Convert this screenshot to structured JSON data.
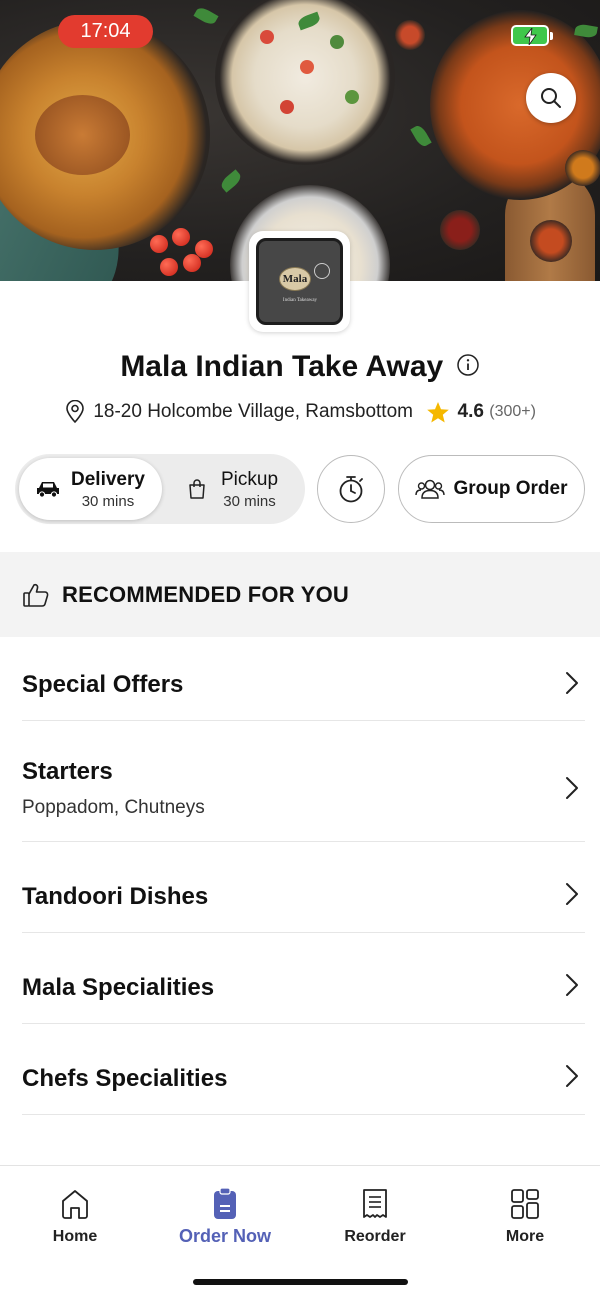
{
  "status_bar": {
    "time": "17:04"
  },
  "restaurant": {
    "name": "Mala Indian Take Away",
    "address": "18-20 Holcombe Village, Ramsbottom",
    "rating": "4.6",
    "rating_count": "(300+)",
    "logo_text": "Mala",
    "logo_subtext": "Indian Takeaway"
  },
  "order_mode": {
    "delivery": {
      "label": "Delivery",
      "time": "30 mins"
    },
    "pickup": {
      "label": "Pickup",
      "time": "30 mins"
    },
    "selected": "delivery"
  },
  "group_order_label": "Group Order",
  "recommended_title": "RECOMMENDED FOR YOU",
  "menu_categories": [
    {
      "name": "Special Offers",
      "description": ""
    },
    {
      "name": "Starters",
      "description": "Poppadom, Chutneys"
    },
    {
      "name": "Tandoori Dishes",
      "description": ""
    },
    {
      "name": "Mala Specialities",
      "description": ""
    },
    {
      "name": "Chefs Specialities",
      "description": ""
    }
  ],
  "bottom_nav": [
    {
      "label": "Home",
      "icon": "home-icon"
    },
    {
      "label": "Order Now",
      "icon": "order-icon",
      "active": true
    },
    {
      "label": "Reorder",
      "icon": "receipt-icon"
    },
    {
      "label": "More",
      "icon": "grid-icon"
    }
  ],
  "colors": {
    "accent": "#5461b6",
    "time_pill": "#e23b2f",
    "star": "#f5b800"
  }
}
